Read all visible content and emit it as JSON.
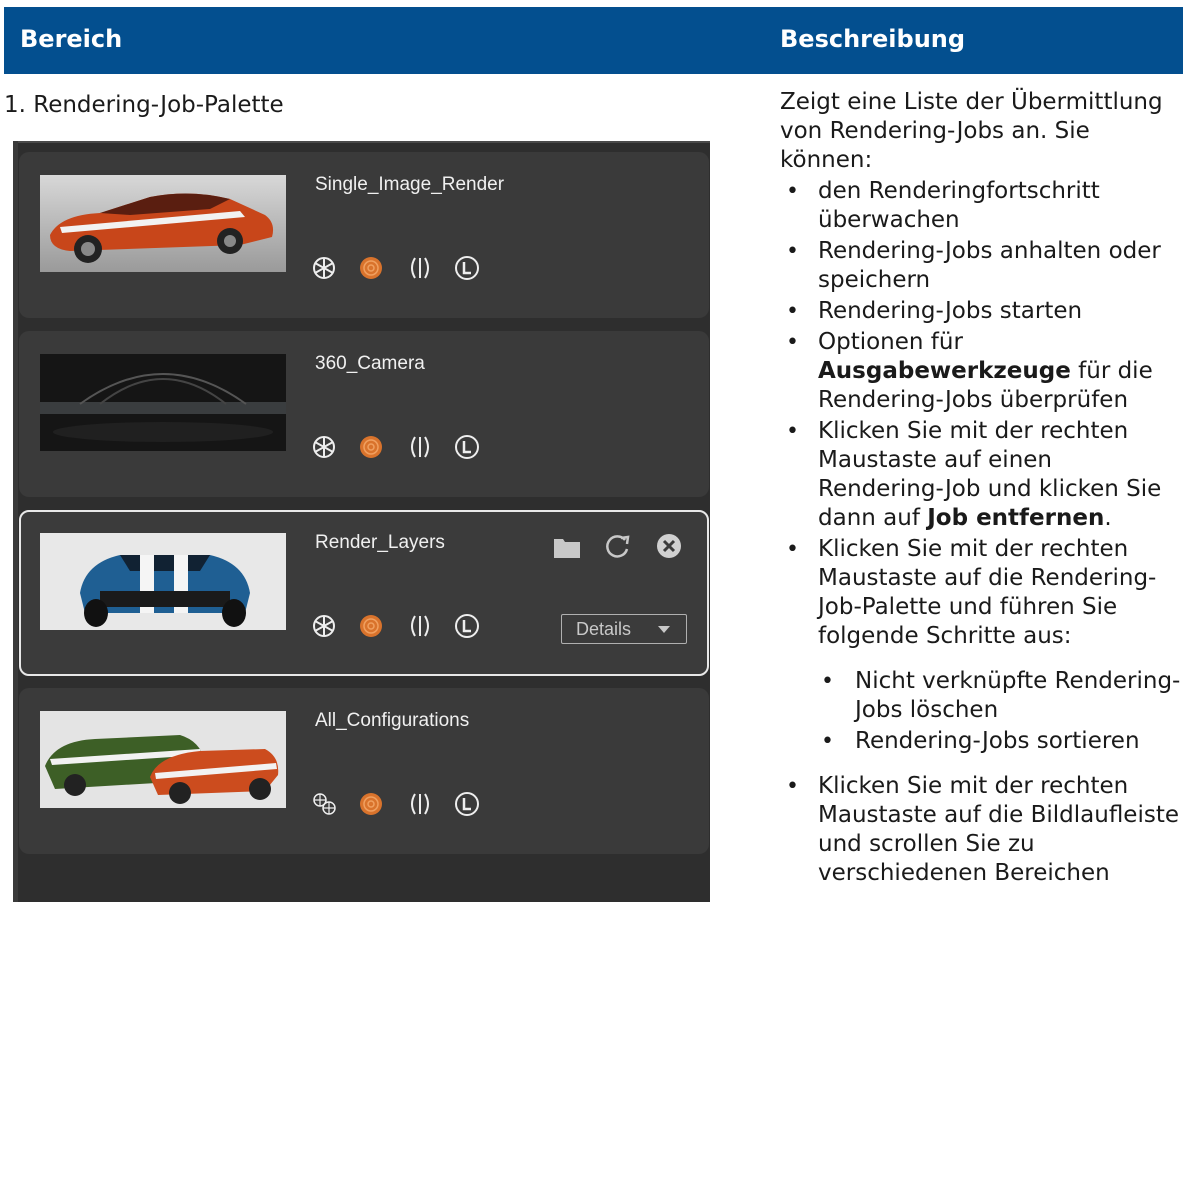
{
  "header": {
    "col1": "Bereich",
    "col2": "Beschreibung"
  },
  "area": {
    "title": "1. Rendering-Job-Palette"
  },
  "jobs": [
    {
      "name": "Single_Image_Render"
    },
    {
      "name": "360_Camera"
    },
    {
      "name": "Render_Layers",
      "details_label": "Details"
    },
    {
      "name": "All_Configurations"
    }
  ],
  "description": {
    "intro": "Zeigt eine Liste der Übermittlung von Rendering-Jobs an. Sie können:",
    "items": [
      "den Renderingfortschritt überwachen",
      "Rendering-Jobs anhalten oder speichern",
      "Rendering-Jobs starten",
      {
        "a": "Optionen für ",
        "b": "Ausgabewerkzeuge",
        "c": " für die Rendering-Jobs überprüfen"
      },
      {
        "a": "Klicken Sie mit der rechten Maustaste auf einen Rendering-Job und klicken Sie dann auf ",
        "b": "Job entfernen",
        "c": "."
      },
      "Klicken Sie mit der rechten Maustaste auf die Rendering-Job-Palette und führen Sie folgende Schritte aus:"
    ],
    "subitems": [
      "Nicht verknüpfte Rendering-Jobs löschen",
      "Rendering-Jobs sortieren"
    ],
    "last_item": "Klicken Sie mit der rechten Maustaste auf die Bildlaufleiste und scrollen Sie zu verschiedenen Bereichen"
  },
  "colors": {
    "header_bg": "#034f8f",
    "palette_bg": "#2e2e2e",
    "accent_orange": "#d9732c"
  }
}
